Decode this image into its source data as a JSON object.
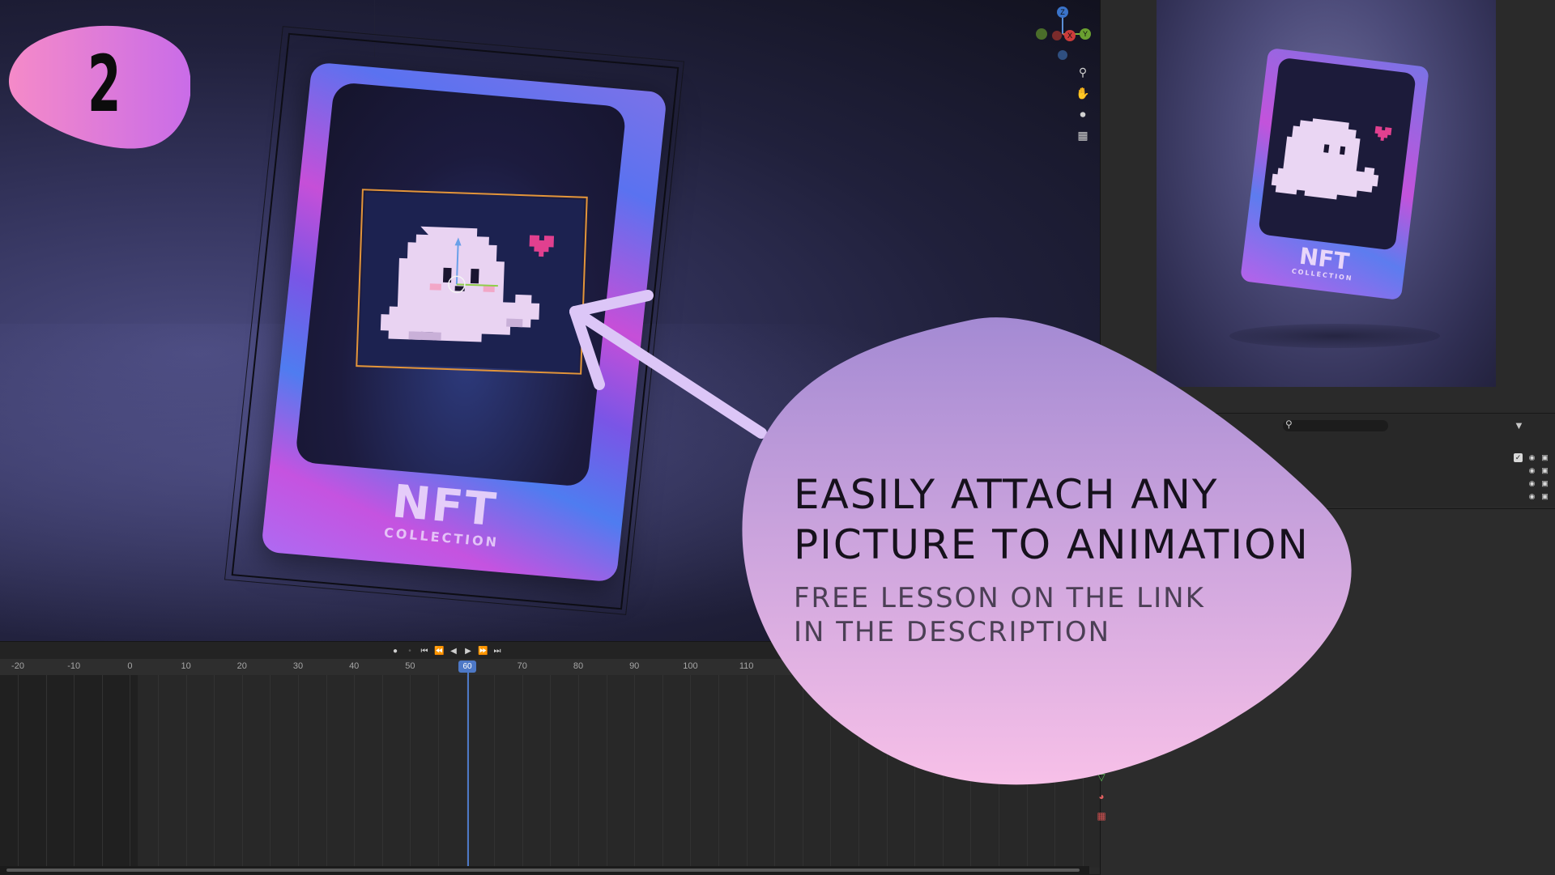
{
  "badge": {
    "number": "2"
  },
  "headline": {
    "line1": "EASILY ATTACH ANY",
    "line2": "PICTURE TO ANIMATION"
  },
  "subline": {
    "line1": "FREE LESSON ON THE LINK",
    "line2": "IN THE DESCRIPTION"
  },
  "card": {
    "title": "NFT",
    "subtitle": "COLLECTION"
  },
  "render_card": {
    "title": "NFT",
    "subtitle": "COLLECTION"
  },
  "timeline": {
    "current_frame": "60",
    "ruler_ticks": [
      "-20",
      "-10",
      "0",
      "10",
      "20",
      "30",
      "40",
      "50",
      "60",
      "70",
      "80",
      "90",
      "100",
      "110"
    ]
  },
  "gizmo": {
    "z": "Z",
    "y": "Y",
    "x": "X"
  },
  "colors": {
    "badge_gradient_start": "#f58ac8",
    "badge_gradient_end": "#c96ce8",
    "bubble_top": "#a48ad3",
    "bubble_bottom": "#f7c0e8",
    "playhead": "#4d78c6",
    "selection_outline": "#e3953a"
  },
  "icons": {
    "viewport_nav": [
      "zoom-icon",
      "pan-hand-icon",
      "camera-icon",
      "grid-perspective-icon"
    ],
    "outliner": [
      "filter-icon",
      "search-icon",
      "checkbox-icon",
      "eye-icon",
      "camera-render-icon"
    ],
    "properties": [
      "modifier-wrench-icon",
      "object-data-icon",
      "material-icon",
      "texture-icon"
    ]
  }
}
